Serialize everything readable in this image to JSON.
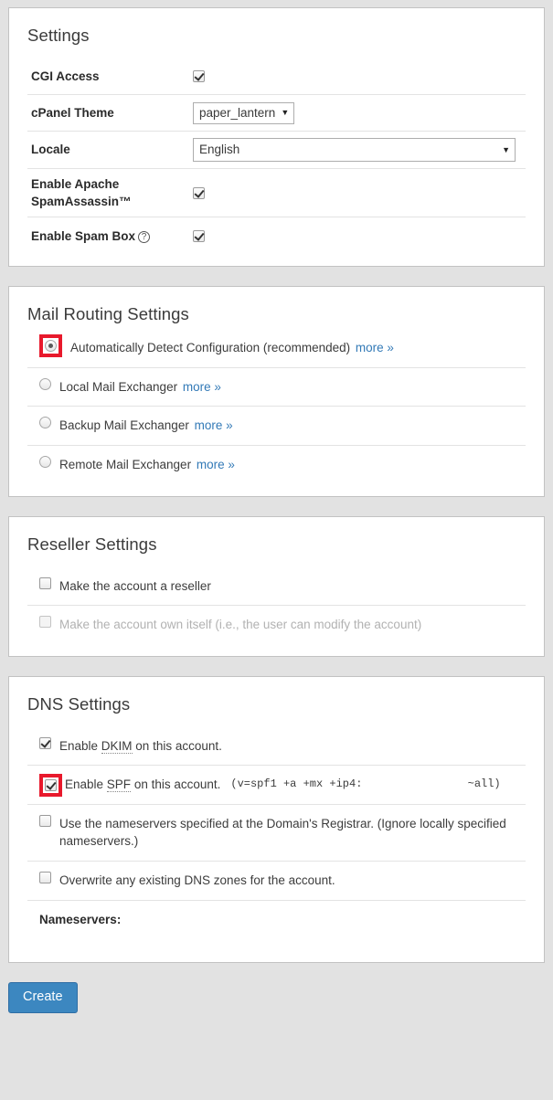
{
  "settings": {
    "title": "Settings",
    "rows": [
      {
        "label": "CGI Access",
        "control": "checkbox",
        "checked": true
      },
      {
        "label": "cPanel Theme",
        "control": "select",
        "value": "paper_lantern"
      },
      {
        "label": "Locale",
        "control": "select",
        "value": "English"
      },
      {
        "label": "Enable Apache SpamAssassin™",
        "control": "checkbox",
        "checked": true
      },
      {
        "label": "Enable Spam Box",
        "control": "checkbox",
        "checked": true,
        "help_icon": "question-circle-icon"
      }
    ]
  },
  "mail_routing": {
    "title": "Mail Routing Settings",
    "more_label": "more »",
    "options": [
      {
        "label": "Automatically Detect Configuration (recommended)",
        "selected": true,
        "more": true,
        "highlighted": true
      },
      {
        "label": "Local Mail Exchanger",
        "selected": false,
        "more": true,
        "highlighted": false
      },
      {
        "label": "Backup Mail Exchanger",
        "selected": false,
        "more": true,
        "highlighted": false
      },
      {
        "label": "Remote Mail Exchanger",
        "selected": false,
        "more": true,
        "highlighted": false
      }
    ]
  },
  "reseller": {
    "title": "Reseller Settings",
    "options": [
      {
        "label": "Make the account a reseller",
        "checked": false,
        "disabled": false
      },
      {
        "label": "Make the account own itself (i.e., the user can modify the account)",
        "checked": false,
        "disabled": true
      }
    ]
  },
  "dns": {
    "title": "DNS Settings",
    "dkim": {
      "prefix": "Enable ",
      "abbr": "DKIM",
      "suffix": " on this account.",
      "checked": true,
      "highlighted": false
    },
    "spf": {
      "prefix": "Enable ",
      "abbr": "SPF",
      "suffix": " on this account.",
      "record": "(v=spf1 +a +mx +ip4:                ~all)",
      "checked": true,
      "highlighted": true
    },
    "registrar_nameservers": {
      "label": "Use the nameservers specified at the Domain's Registrar. (Ignore locally specified nameservers.)",
      "checked": false
    },
    "overwrite_zones": {
      "label": "Overwrite any existing DNS zones for the account.",
      "checked": false
    },
    "nameservers_label": "Nameservers:"
  },
  "footer": {
    "create_label": "Create"
  },
  "colors": {
    "accent_blue": "#337ab7",
    "button_blue": "#3c87c0",
    "highlight_red": "#e8192c",
    "page_bg": "#e2e2e2"
  }
}
